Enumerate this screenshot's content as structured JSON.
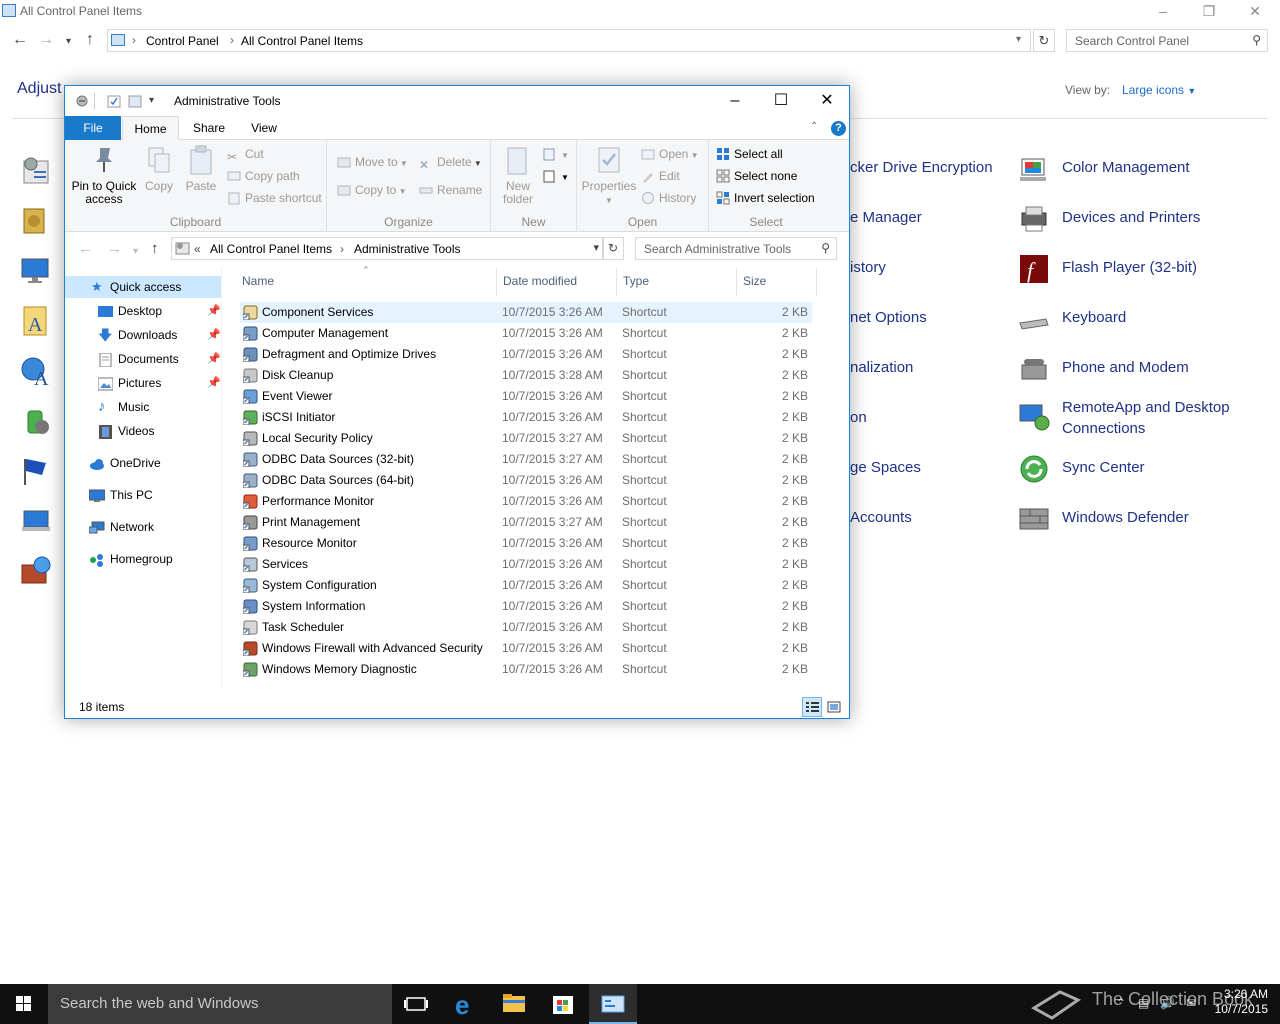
{
  "background_window": {
    "title": "All Control Panel Items",
    "breadcrumb": [
      "Control Panel",
      "All Control Panel Items"
    ],
    "search_placeholder": "Search Control Panel",
    "heading_partial": "Adjust",
    "view_by_label": "View by:",
    "view_by_value": "Large icons",
    "middle_column_partial": [
      "cker Drive Encryption",
      "e Manager",
      "istory",
      "net Options",
      "nalization",
      "on",
      "ge Spaces",
      "Accounts"
    ],
    "right_column": [
      {
        "label": "Color Management",
        "icon": "color-management-icon"
      },
      {
        "label": "Devices and Printers",
        "icon": "devices-printers-icon"
      },
      {
        "label": "Flash Player (32-bit)",
        "icon": "flash-player-icon"
      },
      {
        "label": "Keyboard",
        "icon": "keyboard-icon"
      },
      {
        "label": "Phone and Modem",
        "icon": "phone-modem-icon"
      },
      {
        "label": "RemoteApp and Desktop Connections",
        "icon": "remoteapp-icon"
      },
      {
        "label": "Sync Center",
        "icon": "sync-center-icon"
      },
      {
        "label": "Windows Defender",
        "icon": "windows-defender-icon"
      }
    ]
  },
  "window": {
    "title": "Administrative Tools",
    "tabs": {
      "file": "File",
      "home": "Home",
      "share": "Share",
      "view": "View"
    },
    "help": "?",
    "ribbon": {
      "clipboard": {
        "label": "Clipboard",
        "pin": "Pin to Quick access",
        "copy": "Copy",
        "paste": "Paste",
        "cut": "Cut",
        "copy_path": "Copy path",
        "paste_shortcut": "Paste shortcut"
      },
      "organize": {
        "label": "Organize",
        "move_to": "Move to",
        "copy_to": "Copy to",
        "delete": "Delete",
        "rename": "Rename"
      },
      "new": {
        "label": "New",
        "new_folder": "New folder"
      },
      "open": {
        "label": "Open",
        "properties": "Properties",
        "open": "Open",
        "edit": "Edit",
        "history": "History"
      },
      "select": {
        "label": "Select",
        "select_all": "Select all",
        "select_none": "Select none",
        "invert": "Invert selection"
      }
    },
    "address": {
      "overflow": "«",
      "crumb1": "All Control Panel Items",
      "crumb2": "Administrative Tools"
    },
    "search_placeholder": "Search Administrative Tools",
    "nav": {
      "quick_access": "Quick access",
      "pinned": [
        "Desktop",
        "Downloads",
        "Documents",
        "Pictures"
      ],
      "unpinned": [
        "Music",
        "Videos"
      ],
      "onedrive": "OneDrive",
      "this_pc": "This PC",
      "network": "Network",
      "homegroup": "Homegroup"
    },
    "columns": {
      "name": "Name",
      "date": "Date modified",
      "type": "Type",
      "size": "Size"
    },
    "files": [
      {
        "name": "Component Services",
        "date": "10/7/2015 3:26 AM",
        "type": "Shortcut",
        "size": "2 KB",
        "icon": "component-services-icon"
      },
      {
        "name": "Computer Management",
        "date": "10/7/2015 3:26 AM",
        "type": "Shortcut",
        "size": "2 KB",
        "icon": "computer-management-icon"
      },
      {
        "name": "Defragment and Optimize Drives",
        "date": "10/7/2015 3:26 AM",
        "type": "Shortcut",
        "size": "2 KB",
        "icon": "defragment-icon"
      },
      {
        "name": "Disk Cleanup",
        "date": "10/7/2015 3:28 AM",
        "type": "Shortcut",
        "size": "2 KB",
        "icon": "disk-cleanup-icon"
      },
      {
        "name": "Event Viewer",
        "date": "10/7/2015 3:26 AM",
        "type": "Shortcut",
        "size": "2 KB",
        "icon": "event-viewer-icon"
      },
      {
        "name": "iSCSI Initiator",
        "date": "10/7/2015 3:26 AM",
        "type": "Shortcut",
        "size": "2 KB",
        "icon": "iscsi-initiator-icon"
      },
      {
        "name": "Local Security Policy",
        "date": "10/7/2015 3:27 AM",
        "type": "Shortcut",
        "size": "2 KB",
        "icon": "local-security-policy-icon"
      },
      {
        "name": "ODBC Data Sources (32-bit)",
        "date": "10/7/2015 3:27 AM",
        "type": "Shortcut",
        "size": "2 KB",
        "icon": "odbc-icon"
      },
      {
        "name": "ODBC Data Sources (64-bit)",
        "date": "10/7/2015 3:26 AM",
        "type": "Shortcut",
        "size": "2 KB",
        "icon": "odbc-icon"
      },
      {
        "name": "Performance Monitor",
        "date": "10/7/2015 3:26 AM",
        "type": "Shortcut",
        "size": "2 KB",
        "icon": "performance-monitor-icon"
      },
      {
        "name": "Print Management",
        "date": "10/7/2015 3:27 AM",
        "type": "Shortcut",
        "size": "2 KB",
        "icon": "print-management-icon"
      },
      {
        "name": "Resource Monitor",
        "date": "10/7/2015 3:26 AM",
        "type": "Shortcut",
        "size": "2 KB",
        "icon": "resource-monitor-icon"
      },
      {
        "name": "Services",
        "date": "10/7/2015 3:26 AM",
        "type": "Shortcut",
        "size": "2 KB",
        "icon": "services-icon"
      },
      {
        "name": "System Configuration",
        "date": "10/7/2015 3:26 AM",
        "type": "Shortcut",
        "size": "2 KB",
        "icon": "system-configuration-icon"
      },
      {
        "name": "System Information",
        "date": "10/7/2015 3:26 AM",
        "type": "Shortcut",
        "size": "2 KB",
        "icon": "system-information-icon"
      },
      {
        "name": "Task Scheduler",
        "date": "10/7/2015 3:26 AM",
        "type": "Shortcut",
        "size": "2 KB",
        "icon": "task-scheduler-icon"
      },
      {
        "name": "Windows Firewall with Advanced Security",
        "date": "10/7/2015 3:26 AM",
        "type": "Shortcut",
        "size": "2 KB",
        "icon": "windows-firewall-icon"
      },
      {
        "name": "Windows Memory Diagnostic",
        "date": "10/7/2015 3:26 AM",
        "type": "Shortcut",
        "size": "2 KB",
        "icon": "memory-diagnostic-icon"
      }
    ],
    "status": "18 items"
  },
  "taskbar": {
    "search_placeholder": "Search the web and Windows",
    "time": "3:26 AM",
    "date": "10/7/2015",
    "watermark": "The Collection Book"
  },
  "colors": {
    "accent": "#1979ca",
    "link": "#1e3287",
    "selection": "#cce8ff",
    "taskbar": "#101010"
  }
}
